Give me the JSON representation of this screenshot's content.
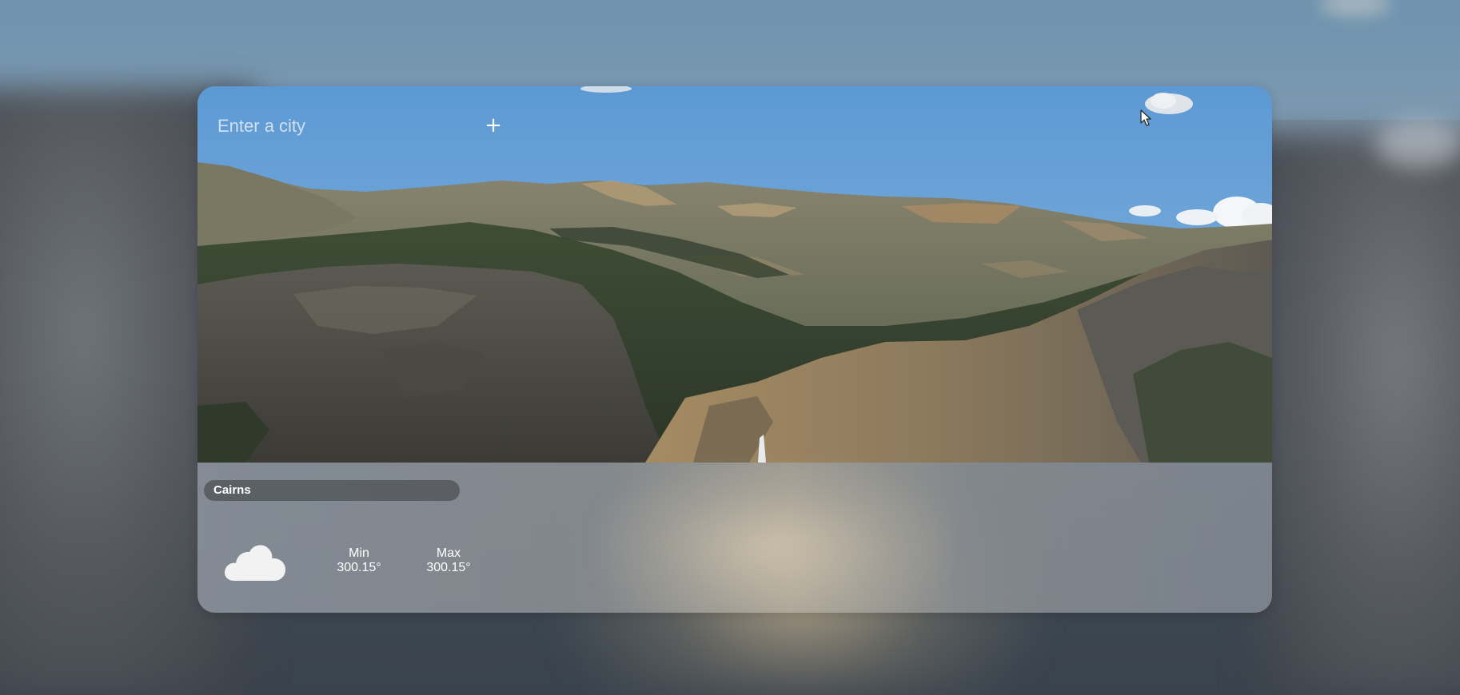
{
  "search": {
    "placeholder": "Enter a city",
    "add_label": "+"
  },
  "weather": {
    "city": "Cairns",
    "icon": "cloud-icon",
    "min_label": "Min",
    "min_value": "300.15°",
    "max_label": "Max",
    "max_value": "300.15°"
  },
  "colors": {
    "sky_top": "#5f9ad2",
    "sky_bottom": "#8cb8e0",
    "pill": "#55585c",
    "text": "#ffffff"
  }
}
